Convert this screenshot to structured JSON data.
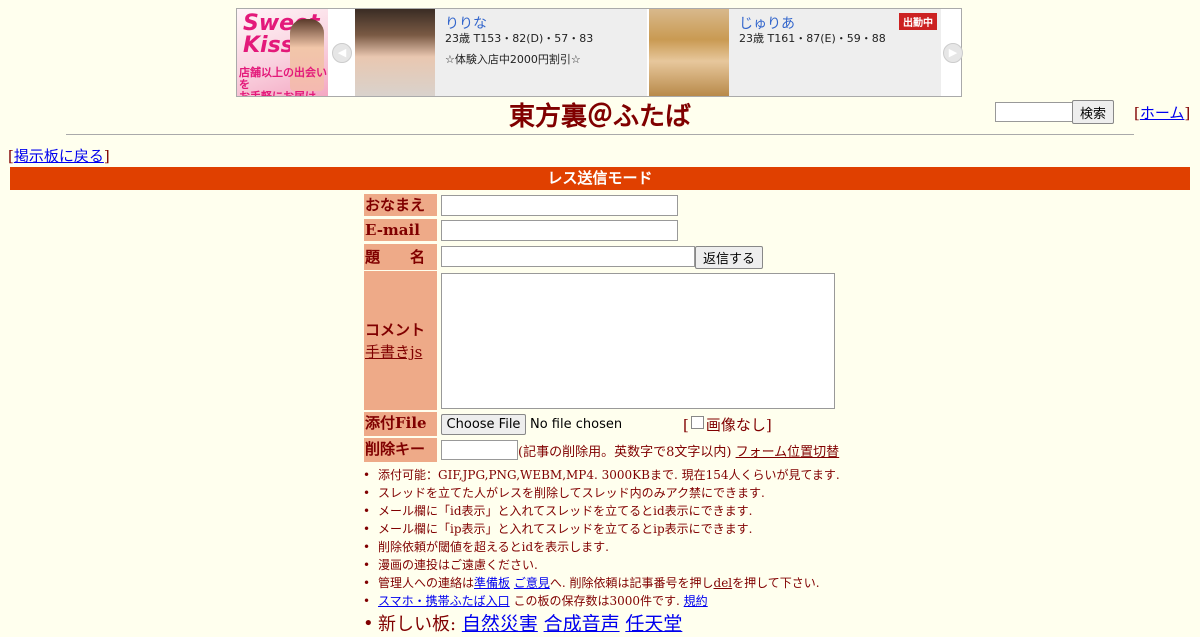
{
  "ad": {
    "logo_text": "Sweet Kiss",
    "logo_sub": "店舗以上の出会いを\nお手軽にお届け",
    "cards": [
      {
        "name": "りりな",
        "stats": "23歳 T153・82(D)・57・83",
        "note": "☆体験入店中2000円割引☆",
        "badge": ""
      },
      {
        "name": "じゅりあ",
        "stats": "23歳 T161・87(E)・59・88",
        "note": "",
        "badge": "出勤中"
      }
    ]
  },
  "header": {
    "title": "東方裏＠ふたば",
    "search_button": "検索",
    "home_link": "ホーム",
    "back_link": "掲示板に戻る"
  },
  "mode_bar": "レス送信モード",
  "form": {
    "name_label": "おなまえ",
    "email_label": "E-mail",
    "subject_label": "題　　名",
    "submit_button": "返信する",
    "comment_label": "コメント",
    "handwriting_link": "手書きjs",
    "file_label": "添付File",
    "choose_file_button": "Choose File",
    "file_status": "No file chosen",
    "no_image_label": "画像なし",
    "delkey_label": "削除キー",
    "delkey_note": "(記事の削除用。英数字で8文字以内)",
    "form_position_link": "フォーム位置切替"
  },
  "rules": {
    "r1": "添付可能：GIF,JPG,PNG,WEBM,MP4. 3000KBまで. 現在154人くらいが見てます.",
    "r2": "スレッドを立てた人がレスを削除してスレッド内のみアク禁にできます.",
    "r3": "メール欄に「id表示」と入れてスレッドを立てるとid表示にできます.",
    "r4": "メール欄に「ip表示」と入れてスレッドを立てるとip表示にできます.",
    "r5": "削除依頼が閾値を超えるとidを表示します.",
    "r6": "漫画の連投はご遠慮ください.",
    "r7_prefix": "管理人への連絡は",
    "r7_link1": "準備板",
    "r7_link2": "ご意見",
    "r7_mid": "へ. 削除依頼は記事番号を押し",
    "r7_del": "del",
    "r7_suffix": "を押して下さい.",
    "r8_link": "スマホ・携帯ふたば入口",
    "r8_text": "この板の保存数は3000件です.",
    "r8_rules_link": "規約",
    "new_boards_label": "新しい板:",
    "new_boards": [
      "自然災害",
      "合成音声",
      "任天堂"
    ]
  },
  "colors": {
    "background": "#ffffee",
    "text": "#800000",
    "mode_bar": "#e04000",
    "label_bg": "#eeaa88",
    "link": "#0000ee"
  }
}
